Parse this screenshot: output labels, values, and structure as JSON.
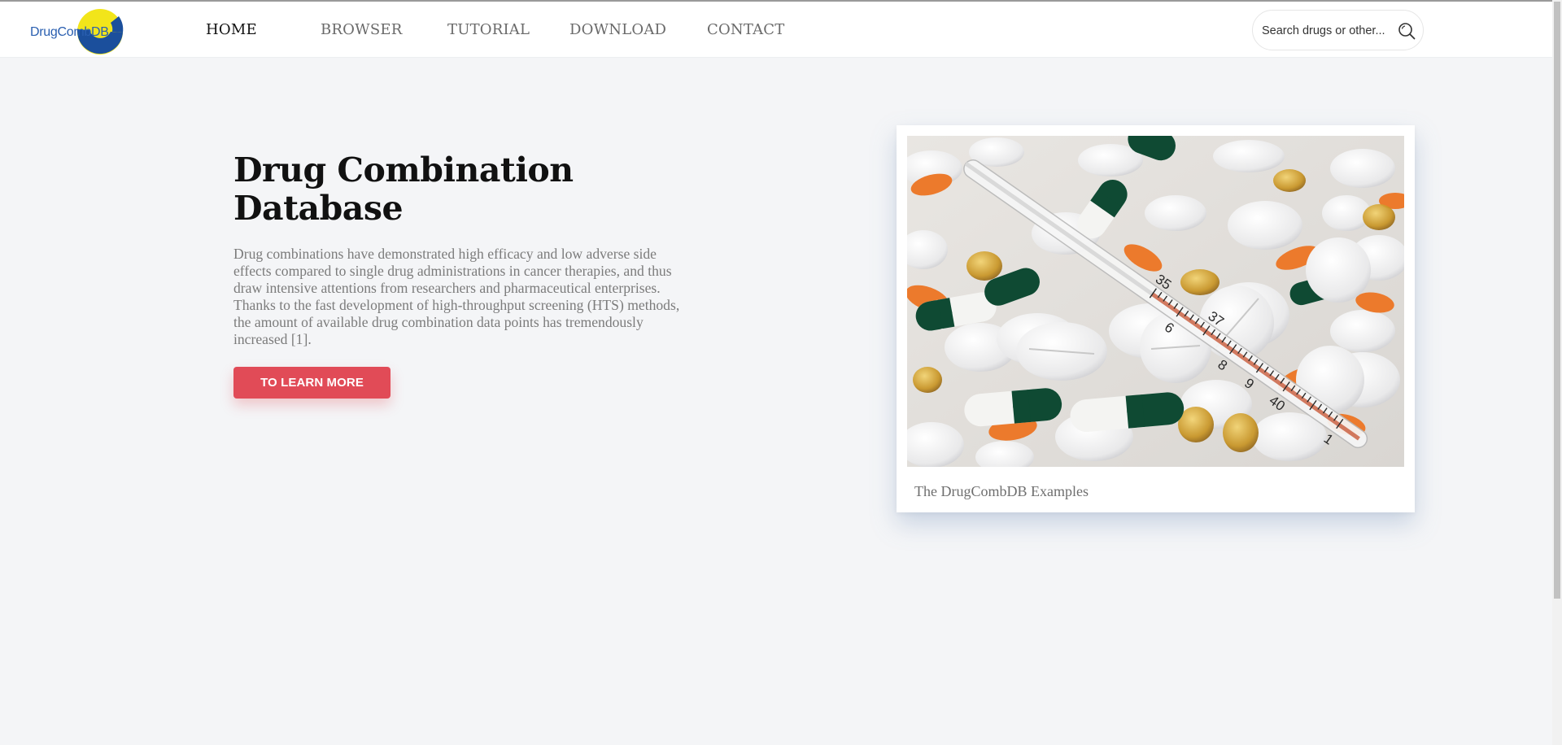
{
  "brand": {
    "logo_text": "DrugCombDB",
    "colors": {
      "blue": "#1b4f9c",
      "yellow": "#f2e51a",
      "accent": "#e14b57"
    }
  },
  "nav": {
    "items": [
      {
        "label": "HOME",
        "active": true
      },
      {
        "label": "BROWSER",
        "active": false
      },
      {
        "label": "TUTORIAL",
        "active": false
      },
      {
        "label": "DOWNLOAD",
        "active": false
      },
      {
        "label": "CONTACT",
        "active": false
      }
    ]
  },
  "search": {
    "placeholder": "Search drugs or other...",
    "icon": "search-icon"
  },
  "hero": {
    "title_line1": "Drug Combination",
    "title_line2": "Database",
    "description": "Drug combinations have demonstrated high efficacy and low adverse side effects compared to single drug administrations in cancer therapies, and thus draw intensive attentions from researchers and pharmaceutical enterprises. Thanks to the fast development of high-throughput screening (HTS) methods, the amount of available drug combination data points has tremendously increased [1].",
    "cta_label": "TO LEARN MORE"
  },
  "card": {
    "caption": "The DrugCombDB Examples",
    "thermometer_marks": [
      "35",
      "6",
      "37",
      "8",
      "9",
      "40",
      "1"
    ]
  }
}
